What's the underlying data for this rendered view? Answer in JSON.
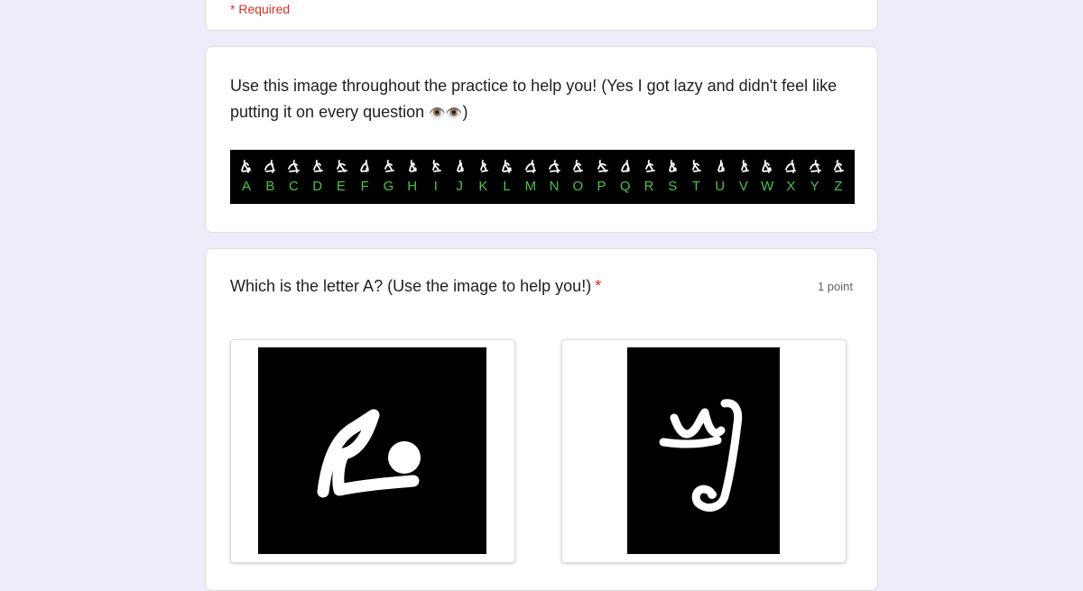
{
  "form": {
    "required_note": "* Required",
    "info_text": "Use this image throughout the practice to help you! (Yes I got lazy and didn't feel like putting it on every question",
    "info_emoji": "👁️👁️",
    "info_close": ")",
    "alphabet_letters": [
      "A",
      "B",
      "C",
      "D",
      "E",
      "F",
      "G",
      "H",
      "I",
      "J",
      "K",
      "L",
      "M",
      "N",
      "O",
      "P",
      "Q",
      "R",
      "S",
      "T",
      "U",
      "V",
      "W",
      "X",
      "Y",
      "Z"
    ],
    "alphabet_label_color": "#4bc34b"
  },
  "question": {
    "title": "Which is the letter A? (Use the image to help you!)",
    "required_marker": "*",
    "points": "1 point",
    "options": [
      {
        "icon": "rune-glyph-a-icon"
      },
      {
        "icon": "rune-glyph-p-icon"
      }
    ]
  },
  "colors": {
    "background": "#efebf8",
    "required": "#d93025",
    "card": "#ffffff"
  }
}
